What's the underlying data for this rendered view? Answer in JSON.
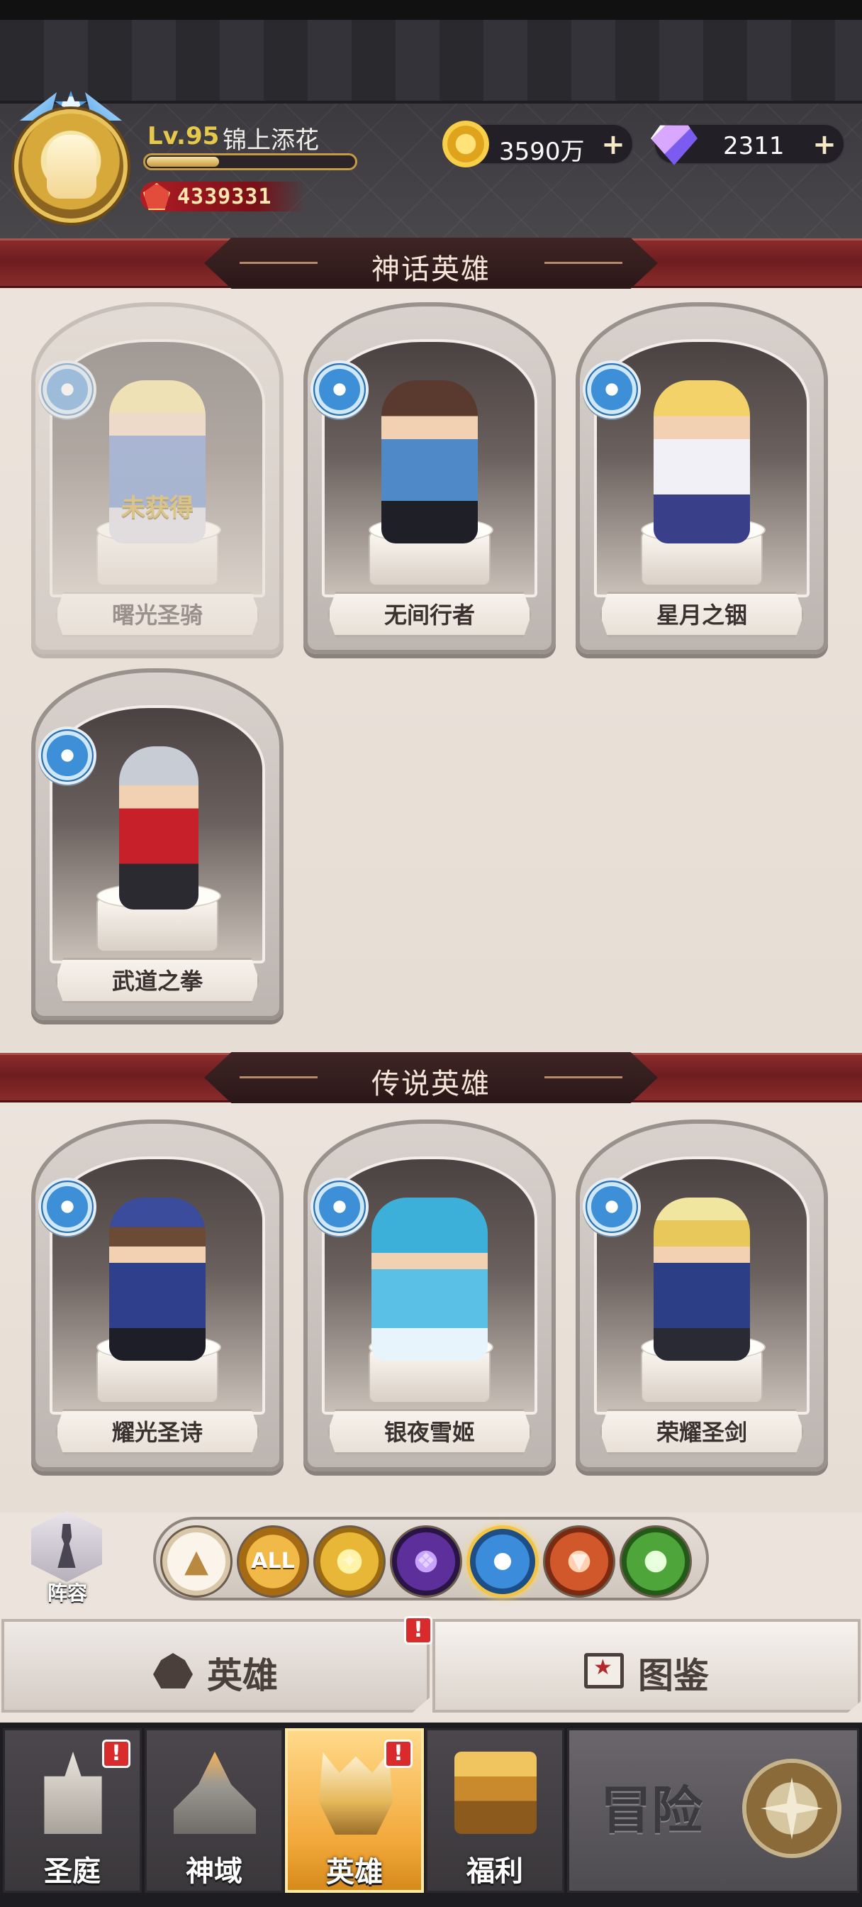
{
  "player": {
    "level": "Lv.95",
    "name": "锦上添花",
    "power": "4339331",
    "xp_fraction": 0.35
  },
  "currencies": {
    "gold": "3590万",
    "diamonds": "2311"
  },
  "sections": {
    "mythic_title": "神话英雄",
    "legendary_title": "传说英雄"
  },
  "mythic_heroes": [
    {
      "name": "曙光圣骑",
      "locked": true,
      "locked_label": "未获得"
    },
    {
      "name": "无间行者",
      "locked": false
    },
    {
      "name": "星月之铟",
      "locked": false
    },
    {
      "name": "武道之拳",
      "locked": false
    }
  ],
  "legendary_heroes": [
    {
      "name": "耀光圣诗"
    },
    {
      "name": "银夜雪姬"
    },
    {
      "name": "荣耀圣剑"
    }
  ],
  "formation_label": "阵容",
  "filters": [
    {
      "icon": "up-arrow-icon",
      "label": ""
    },
    {
      "icon": "all-icon",
      "label": "ALL"
    },
    {
      "icon": "light-element-icon",
      "label": ""
    },
    {
      "icon": "dark-element-icon",
      "label": ""
    },
    {
      "icon": "holy-element-icon",
      "label": "",
      "selected": true
    },
    {
      "icon": "beast-element-icon",
      "label": ""
    },
    {
      "icon": "nature-element-icon",
      "label": ""
    }
  ],
  "tabs": {
    "heroes": "英雄",
    "codex": "图鉴",
    "alert_mark": "!"
  },
  "nav": {
    "court": "圣庭",
    "domain": "神域",
    "heroes": "英雄",
    "welfare": "福利",
    "adventure": "冒险"
  },
  "colors": {
    "banner_red": "#7a1f22",
    "active_nav": "#f2a83a",
    "alert_red": "#d92b2b"
  }
}
